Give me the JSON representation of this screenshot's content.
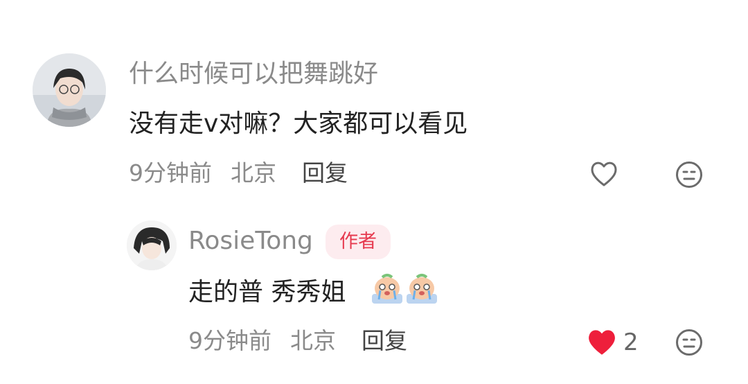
{
  "comment": {
    "username": "什么时候可以把舞跳好",
    "text": "没有走v对嘛？大家都可以看见",
    "time": "9分钟前",
    "location": "北京",
    "reply_label": "回复"
  },
  "reply": {
    "username": "RosieTong",
    "author_badge": "作者",
    "text": "走的普 秀秀姐",
    "emoji": "crying-emoji",
    "time": "9分钟前",
    "location": "北京",
    "reply_label": "回复",
    "like_count": "2",
    "liked": true
  },
  "colors": {
    "like_red": "#ee1f3b",
    "icon_gray": "#6b6b6b",
    "badge_bg": "#fdecef",
    "badge_text": "#e63a4f"
  }
}
